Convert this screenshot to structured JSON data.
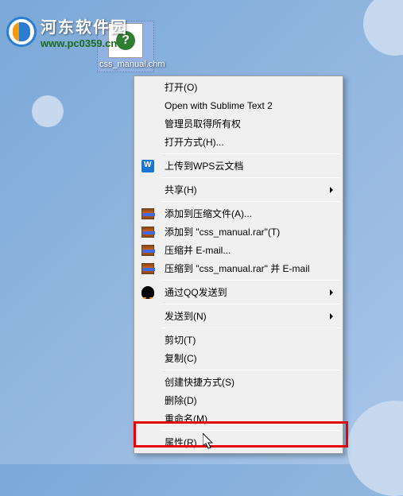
{
  "watermark": {
    "title": "河东软件园",
    "url": "www.pc0359.cn"
  },
  "desktop": {
    "file_name": "css_manual.chm",
    "file_icon_glyph": "?"
  },
  "context_menu": {
    "items": [
      {
        "label": "打开(O)",
        "icon": null,
        "submenu": false,
        "bold": false
      },
      {
        "label": "Open with Sublime Text 2",
        "icon": null,
        "submenu": false,
        "bold": false
      },
      {
        "label": "管理员取得所有权",
        "icon": null,
        "submenu": false,
        "bold": false
      },
      {
        "label": "打开方式(H)...",
        "icon": null,
        "submenu": false,
        "bold": false
      }
    ],
    "group2": [
      {
        "label": "上传到WPS云文档",
        "icon": "wps",
        "submenu": false
      }
    ],
    "group3": [
      {
        "label": "共享(H)",
        "icon": null,
        "submenu": true
      }
    ],
    "group4": [
      {
        "label": "添加到压缩文件(A)...",
        "icon": "rar",
        "submenu": false
      },
      {
        "label": "添加到 \"css_manual.rar\"(T)",
        "icon": "rar",
        "submenu": false
      },
      {
        "label": "压缩并 E-mail...",
        "icon": "rar",
        "submenu": false
      },
      {
        "label": "压缩到 \"css_manual.rar\" 并 E-mail",
        "icon": "rar",
        "submenu": false
      }
    ],
    "group5": [
      {
        "label": "通过QQ发送到",
        "icon": "qq",
        "submenu": true
      }
    ],
    "group6": [
      {
        "label": "发送到(N)",
        "icon": null,
        "submenu": true
      }
    ],
    "group7": [
      {
        "label": "剪切(T)",
        "icon": null,
        "submenu": false
      },
      {
        "label": "复制(C)",
        "icon": null,
        "submenu": false
      }
    ],
    "group8": [
      {
        "label": "创建快捷方式(S)",
        "icon": null,
        "submenu": false
      },
      {
        "label": "删除(D)",
        "icon": null,
        "submenu": false
      },
      {
        "label": "重命名(M)",
        "icon": null,
        "submenu": false
      }
    ],
    "group9": [
      {
        "label": "属性(R)",
        "icon": null,
        "submenu": false
      }
    ]
  }
}
